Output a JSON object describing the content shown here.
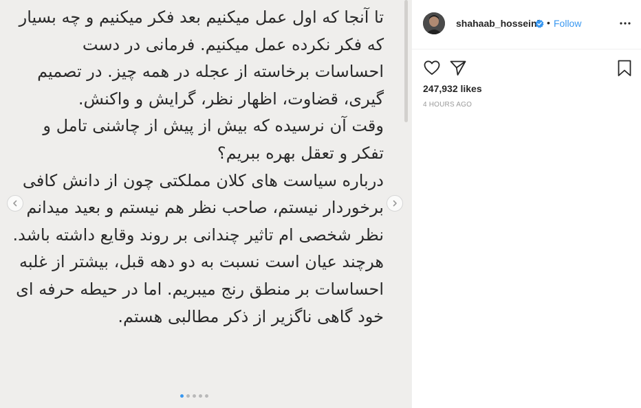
{
  "media": {
    "paragraphs": [
      "تا آنجا که اول عمل میکنیم بعد فکر میکنیم و چه بسیار که فکر نکرده عمل میکنیم. فرمانی در دست احساسات برخاسته از عجله در همه چیز. در تصمیم گیری، قضاوت، اظهار نظر، گرایش و واکنش.",
      "وقت آن نرسیده که بیش از پیش از چاشنی تامل و تفکر و تعقل بهره ببریم؟",
      "درباره سیاست های کلان مملکتی چون از دانش کافی برخوردار نیستم، صاحب نظر هم نیستم و بعید میدانم نظر شخصی ام تاثیر چندانی بر روند وقایع داشته باشد. هرچند عیان است نسبت به دو دهه قبل، بیشتر از غلبه احساسات بر منطق رنج میبریم. اما در حیطه حرفه ای خود گاهی ناگزیر از ذکر مطالبی هستم."
    ],
    "prev_icon": "chevron-left-icon",
    "next_icon": "chevron-right-icon",
    "carousel_count": 5,
    "carousel_active_index": 0
  },
  "header": {
    "username": "shahaab_hosseini",
    "verified_icon": "verified-badge-icon",
    "separator": "•",
    "follow_label": "Follow",
    "more_icon": "more-options-icon"
  },
  "actions": {
    "like_icon": "heart-icon",
    "share_icon": "share-icon",
    "save_icon": "bookmark-icon"
  },
  "likes": "247,932 likes",
  "timestamp": "4 HOURS AGO",
  "colors": {
    "accent": "#3897f0",
    "media_background": "#efeeec",
    "text": "#262626",
    "muted": "#999999"
  }
}
